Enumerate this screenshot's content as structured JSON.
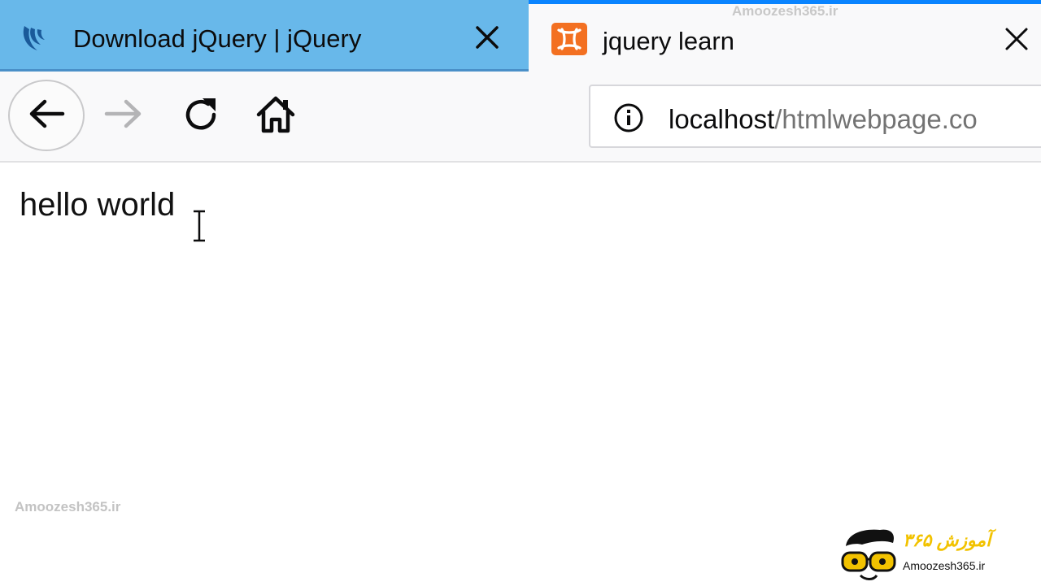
{
  "tabs": [
    {
      "title": "Download jQuery | jQuery",
      "icon": "jquery-logo-icon",
      "active": false
    },
    {
      "title": "jquery learn",
      "icon": "xampp-icon",
      "active": true
    }
  ],
  "watermark": "Amoozesh365.ir",
  "navbar": {
    "url_host": "localhost",
    "url_path": "/htmlwebpage.co",
    "icons": [
      "back-arrow-icon",
      "forward-arrow-icon",
      "reload-icon",
      "home-icon",
      "info-icon"
    ]
  },
  "page": {
    "text": "hello world"
  },
  "logo": {
    "persian_text": "آموزش ۳۶۵",
    "site": "Amoozesh365.ir"
  },
  "colors": {
    "inactive_tab": "#68b8ea",
    "active_tab_accent": "#0a84ff",
    "xampp_orange": "#f37021",
    "logo_yellow": "#f2c200"
  }
}
